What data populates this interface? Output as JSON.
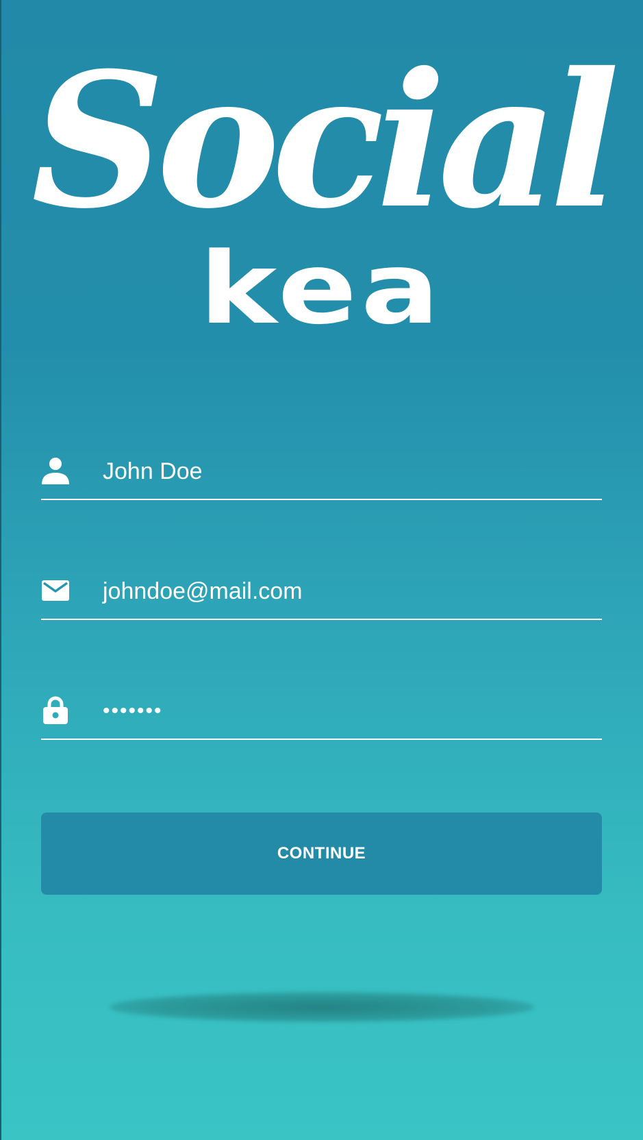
{
  "logo": {
    "line1": "Social",
    "line2": "kea"
  },
  "form": {
    "name": {
      "value": "John Doe",
      "icon": "person-icon"
    },
    "email": {
      "value": "johndoe@mail.com",
      "icon": "envelope-icon"
    },
    "password": {
      "value": "•••••••",
      "icon": "lock-icon"
    },
    "continue_label": "CONTINUE"
  },
  "colors": {
    "background_top": "#228aa8",
    "background_bottom": "#3ac4c4",
    "button": "#238aa8",
    "text": "#ffffff"
  }
}
